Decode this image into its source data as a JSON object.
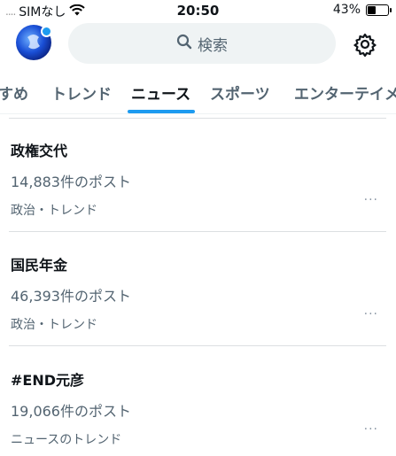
{
  "status_bar": {
    "signal": "....",
    "carrier": "SIMなし",
    "time": "20:50",
    "battery": "43%",
    "battery_level": 0.43
  },
  "header": {
    "search_label": "検索",
    "icons": [
      "profile-avatar",
      "search-icon",
      "gear-icon"
    ]
  },
  "tabs": [
    {
      "label": "すめ"
    },
    {
      "label": "トレンド"
    },
    {
      "label": "ニュース",
      "active": true
    },
    {
      "label": "スポーツ"
    },
    {
      "label": "エンターテイメ"
    }
  ],
  "trends": [
    {
      "title": "政権交代",
      "count": "14,883件のポスト",
      "category": "政治・トレンド",
      "more": "···"
    },
    {
      "title": "国民年金",
      "count": "46,393件のポスト",
      "category": "政治・トレンド",
      "more": "···"
    },
    {
      "title": "#END元彦",
      "count": "19,066件のポスト",
      "category": "ニュースのトレンド",
      "more": "···"
    }
  ],
  "colors": {
    "accent": "#1d9bf0",
    "secondary_text": "#536471",
    "search_bg": "#eff3f4"
  }
}
